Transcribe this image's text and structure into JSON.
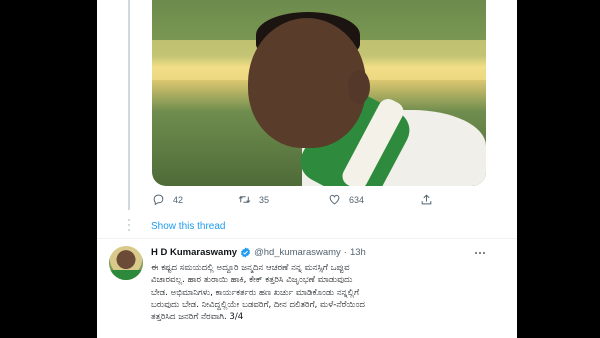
{
  "tweet1": {
    "actions": {
      "reply_count": "42",
      "retweet_count": "35",
      "like_count": "634"
    },
    "show_thread": "Show this thread"
  },
  "tweet2": {
    "author_name": "H D Kumaraswamy",
    "handle": "@hd_kumaraswamy",
    "separator": "·",
    "time": "13h",
    "text": "ಈ ಕಷ್ಟದ ಸಮಯದಲ್ಲಿ ಅದ್ದೂರಿ ಜನ್ಮದಿನ ಆಚರಣೆ ನನ್ನ ಮನಸ್ಸಿಗೆ ಒಪ್ಪುವ\nವಿಚಾರವಲ್ಲ. ಹಾರ ತುರಾಯಿ ಹಾಕಿ, ಕೇಕ್ ಕತ್ತರಿಸಿ ವಿಜೃಂಭಣೆ ಮಾಡುವುದು\nಬೇಡ. ಅಭಿಮಾನಿಗಳು, ಕಾರ್ಯಕರ್ತರು ಹಣ ಖರ್ಚು ಮಾಡಿಕೊಂಡು ನನ್ನಲ್ಲಿಗೆ\nಬರುವುದು ಬೇಡ. ನೀವಿದ್ದಲ್ಲಿಯೇ ಬಡವರಿಗೆ, ದೀನ ದಲಿತರಿಗೆ, ಮಳೆ-ನೆರೆಯಿಂದ\nತತ್ತರಿಸಿದ ಜನರಿಗೆ ನೆರವಾಗಿ. 3/4"
  },
  "colors": {
    "link": "#1d9bf0",
    "text_primary": "#0f1419",
    "text_secondary": "#536471",
    "verified": "#1d9bf0",
    "background": "#000000",
    "card": "#ffffff"
  },
  "icons": [
    "reply-icon",
    "retweet-icon",
    "like-icon",
    "share-icon",
    "verified-badge-icon",
    "more-options-icon"
  ]
}
